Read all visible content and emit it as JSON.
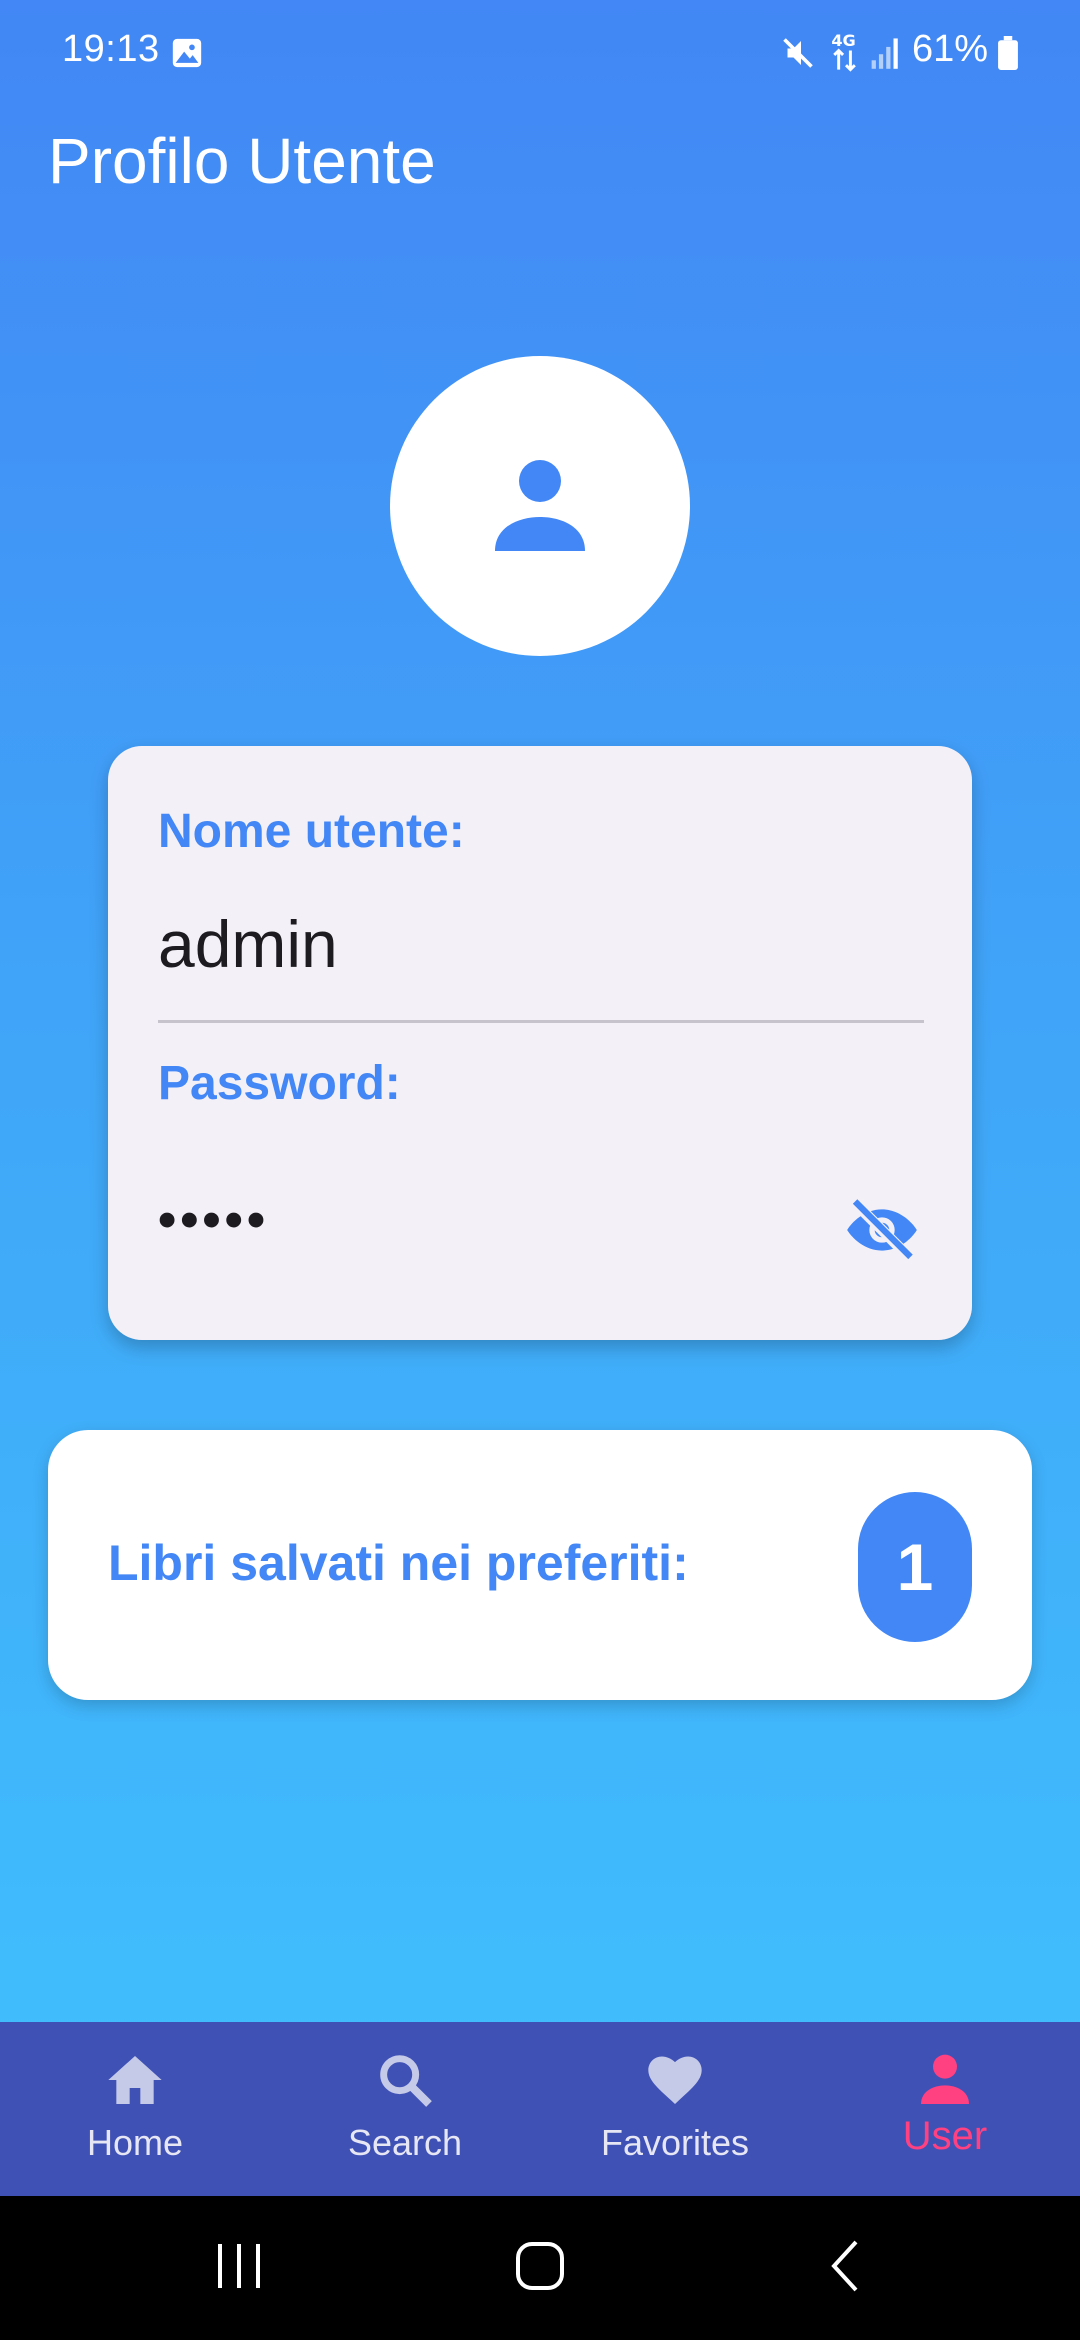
{
  "status_bar": {
    "time": "19:13",
    "battery": "61%",
    "icons": [
      "gallery-icon",
      "mute-icon",
      "4g-data-icon",
      "signal-icon",
      "battery-icon"
    ]
  },
  "app_bar": {
    "title": "Profilo Utente"
  },
  "profile": {
    "avatar_icon": "person-icon",
    "username_label": "Nome utente:",
    "username_value": "admin",
    "password_label": "Password:",
    "password_value": "•••••",
    "visibility_icon": "visibility-off-icon"
  },
  "favorites_card": {
    "label": "Libri salvati nei preferiti:",
    "count": "1"
  },
  "bottom_nav": {
    "items": [
      {
        "label": "Home",
        "icon": "home-icon",
        "active": false
      },
      {
        "label": "Search",
        "icon": "search-icon",
        "active": false
      },
      {
        "label": "Favorites",
        "icon": "heart-icon",
        "active": false
      },
      {
        "label": "User",
        "icon": "person-icon",
        "active": true
      }
    ]
  },
  "colors": {
    "primary": "#4287f5",
    "nav_background": "#3f51b5",
    "nav_active": "#ff4081",
    "card_background": "#f4f0f8"
  }
}
